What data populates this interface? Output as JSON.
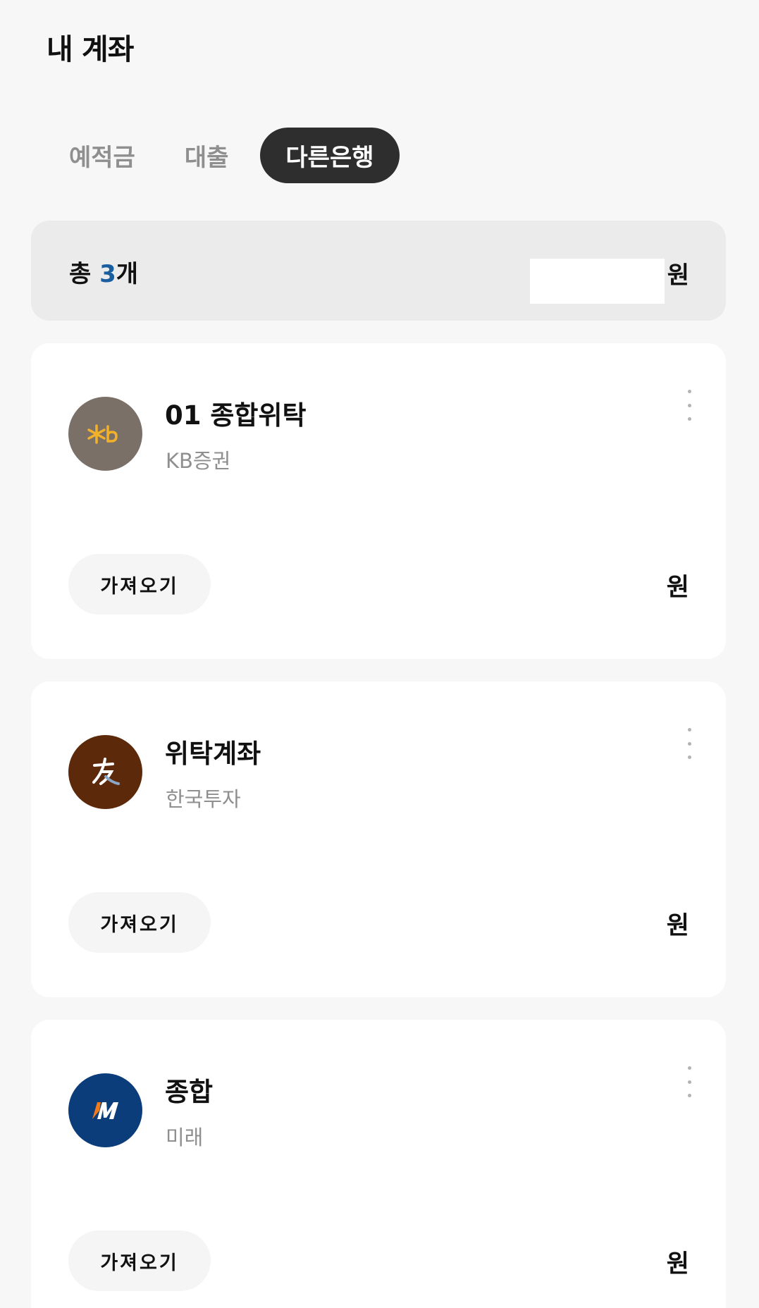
{
  "header": {
    "title": "내 계좌"
  },
  "tabs": [
    {
      "label": "예적금",
      "active": false
    },
    {
      "label": "대출",
      "active": false
    },
    {
      "label": "다른은행",
      "active": true
    }
  ],
  "summary": {
    "prefix": "총 ",
    "count": "3",
    "suffix": "개",
    "unit": "원"
  },
  "accounts": [
    {
      "name": "01 종합위탁",
      "bank": "KB증권",
      "logo_icon": "kb-star-icon",
      "logo_color": "#7a7068",
      "import_label": "가져오기",
      "unit": "원"
    },
    {
      "name": "위탁계좌",
      "bank": "한국투자",
      "logo_icon": "korea-investment-icon",
      "logo_color": "#5c2a0a",
      "import_label": "가져오기",
      "unit": "원"
    },
    {
      "name": "종합",
      "bank": "미래",
      "logo_icon": "mirae-asset-icon",
      "logo_color": "#0b3d7a",
      "import_label": "가져오기",
      "unit": "원"
    }
  ],
  "colors": {
    "background": "#f7f7f7",
    "card": "#ffffff",
    "summary_bg": "#ebebeb",
    "active_tab": "#2e2e2e",
    "count_accent": "#1a5ea0",
    "muted_text": "#8f8f8f"
  }
}
